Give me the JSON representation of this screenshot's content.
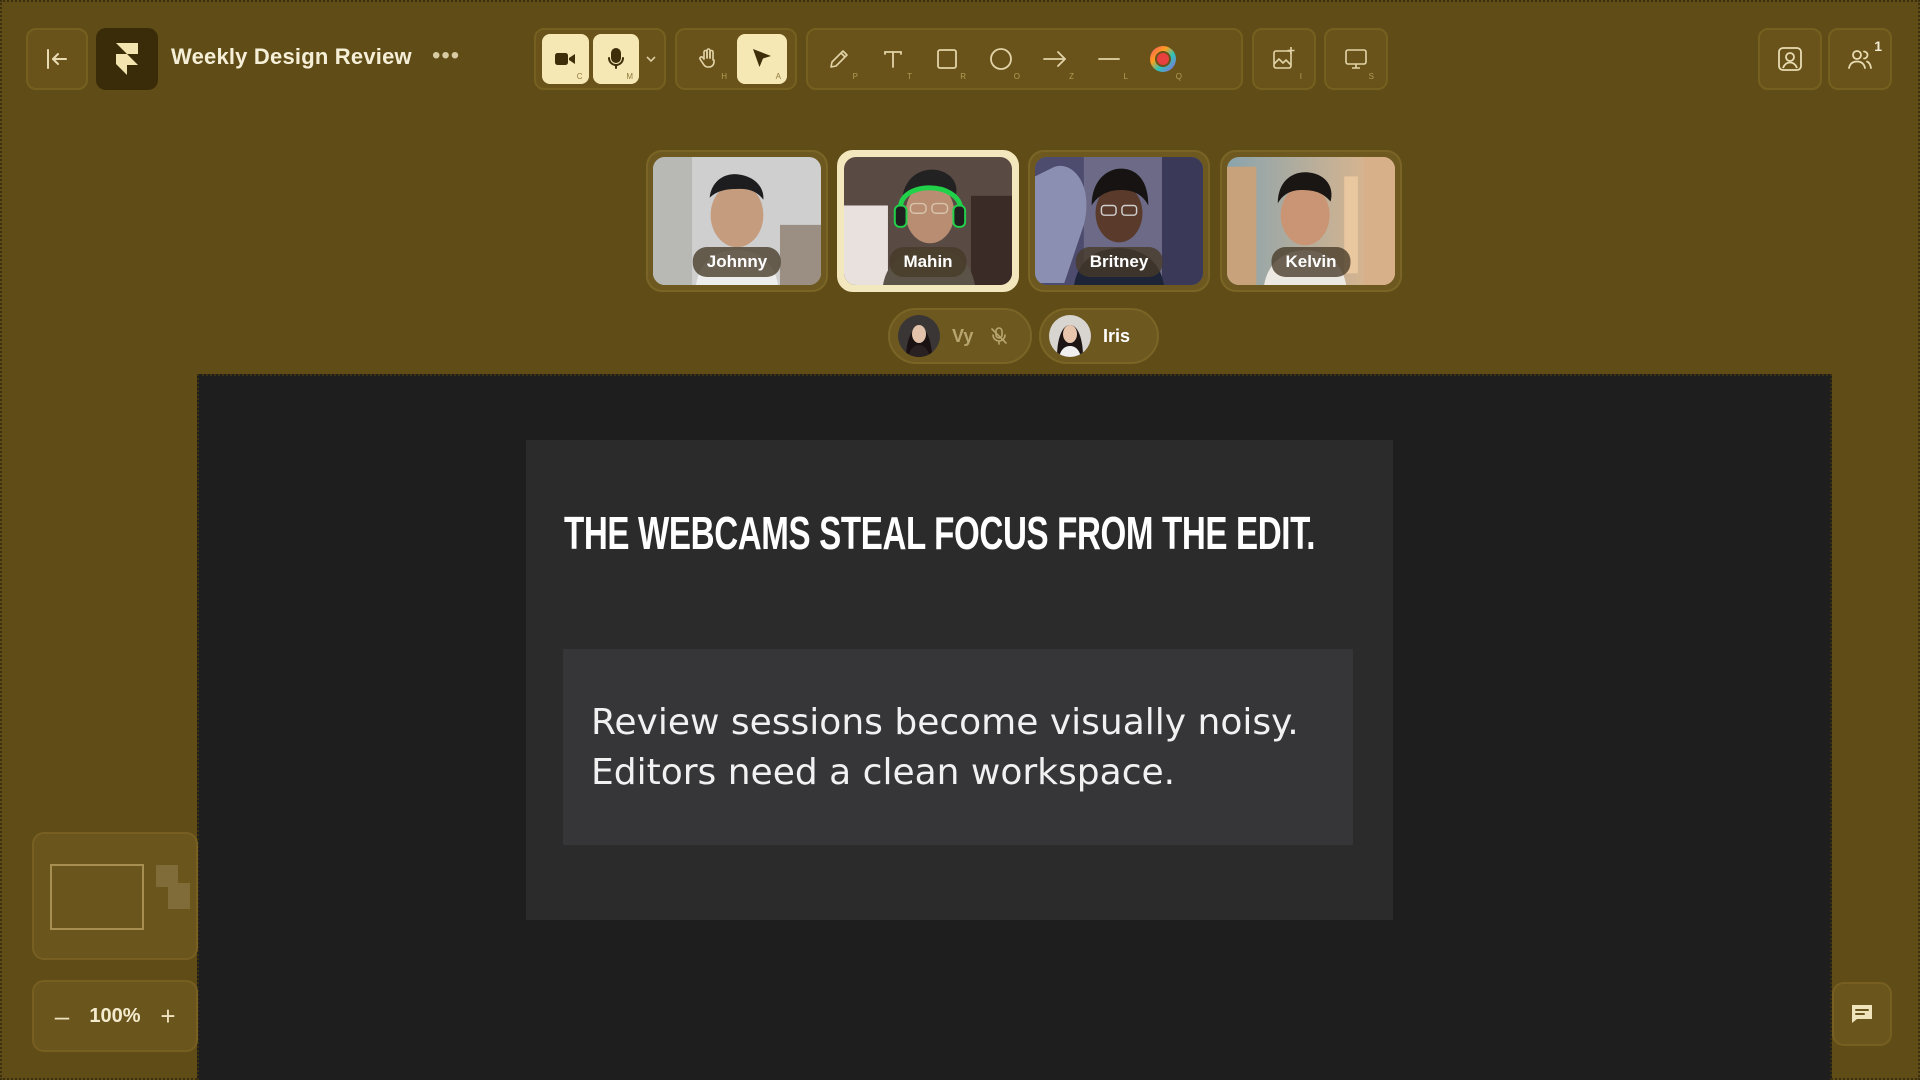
{
  "header": {
    "title": "Weekly Design Review",
    "more_label": "•••",
    "people_count": "1"
  },
  "toolbar": {
    "media": [
      {
        "name": "camera",
        "key": "C",
        "active": true
      },
      {
        "name": "microphone",
        "key": "M",
        "active": true
      }
    ],
    "select": [
      {
        "name": "hand",
        "key": "H"
      },
      {
        "name": "select",
        "key": "A",
        "active": true
      }
    ],
    "draw": [
      {
        "name": "pencil",
        "key": "P"
      },
      {
        "name": "text",
        "key": "T"
      },
      {
        "name": "rectangle",
        "key": "R"
      },
      {
        "name": "ellipse",
        "key": "O"
      },
      {
        "name": "arrow",
        "key": "Z"
      },
      {
        "name": "line",
        "key": "L"
      },
      {
        "name": "color",
        "key": "Q"
      }
    ],
    "image_key": "I",
    "present_key": "S"
  },
  "participants": {
    "tiles": [
      {
        "name": "Johnny"
      },
      {
        "name": "Mahin",
        "speaking": true
      },
      {
        "name": "Britney"
      },
      {
        "name": "Kelvin"
      }
    ],
    "audio": [
      {
        "name": "Vy",
        "muted": true
      },
      {
        "name": "Iris",
        "muted": false
      }
    ]
  },
  "slide": {
    "title": "THE WEBCAMS STEAL FOCUS FROM THE EDIT.",
    "body_line1": "Review sessions become visually noisy.",
    "body_line2": "Editors need a clean workspace."
  },
  "zoom": {
    "value": "100%",
    "minus": "–",
    "plus": "+"
  },
  "colors": {
    "background": "#604c17",
    "canvas": "#1e1e1e",
    "accent": "#f6e8b5"
  }
}
